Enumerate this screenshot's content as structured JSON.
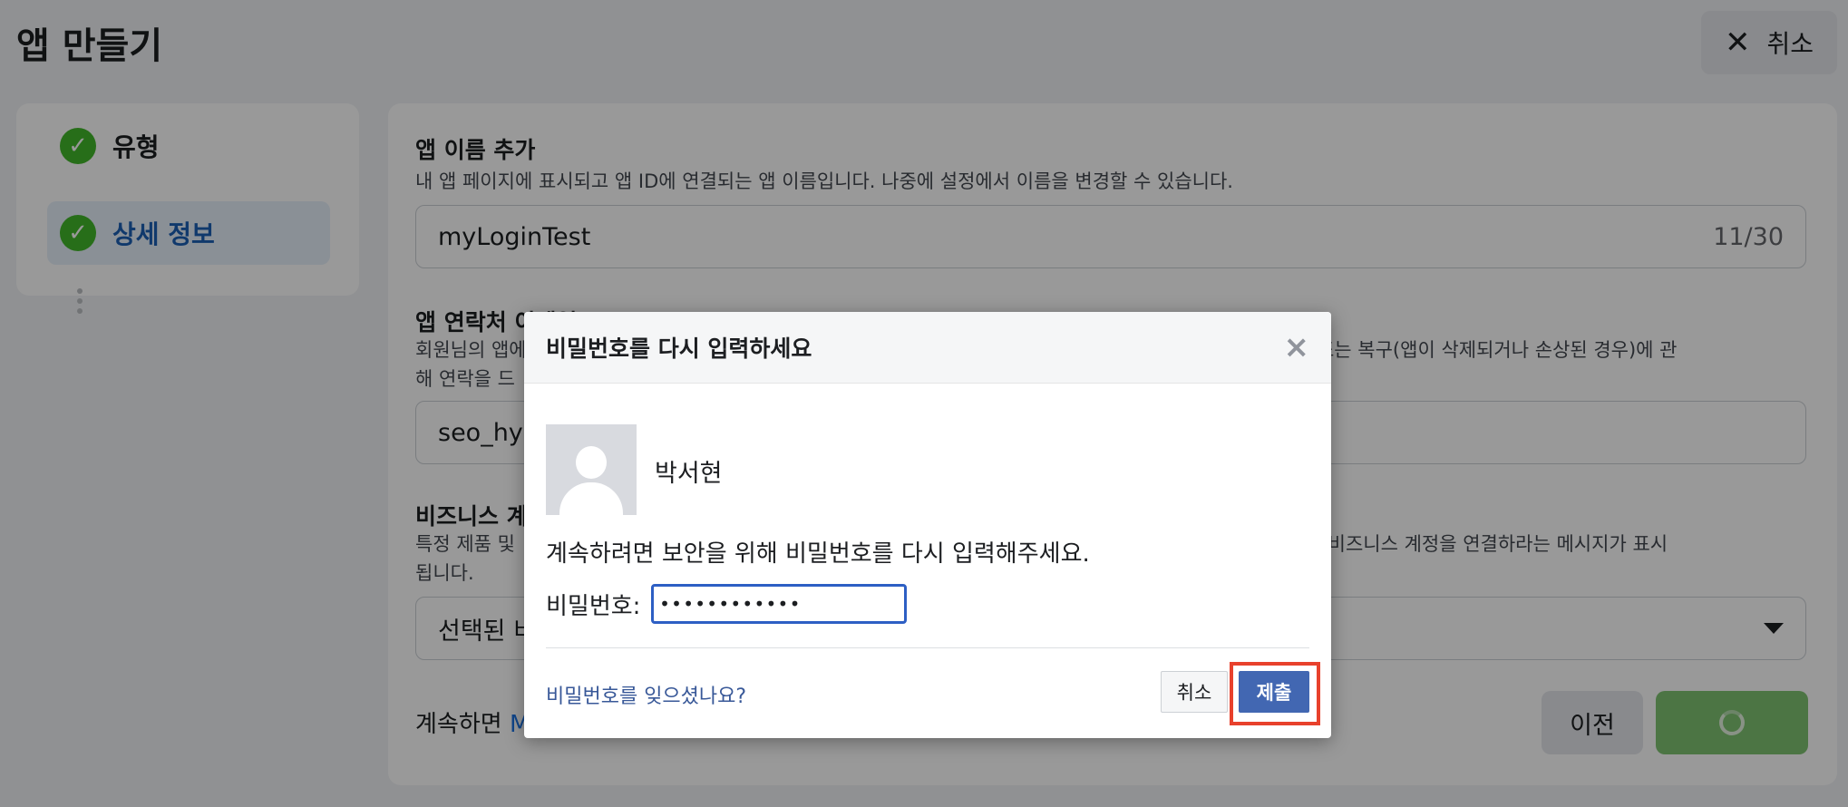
{
  "header": {
    "title": "앱 만들기",
    "cancel_label": "취소"
  },
  "steps": [
    {
      "label": "유형",
      "status": "complete"
    },
    {
      "label": "상세 정보",
      "status": "current"
    }
  ],
  "form": {
    "app_name": {
      "label": "앱 이름 추가",
      "description": "내 앱 페이지에 표시되고 앱 ID에 연결되는 앱 이름입니다. 나중에 설정에서 이름을 변경할 수 있습니다.",
      "value": "myLoginTest",
      "counter": "11/30"
    },
    "contact_email": {
      "label": "앱 연락처 이메일",
      "description_left": "회원님의 앱에",
      "description_right": "택, 앱 제한 또는 복구(앱이 삭제되거나 손상된 경우)에 관",
      "description_line2": "해 연락을 드",
      "value": "seo_hye"
    },
    "business": {
      "label": "비즈니스 계",
      "description_left": "특정 제품 및",
      "description_right": "을 요청할 때 비즈니스 계정을 연결하라는 메시지가 표시",
      "description_line2": "됩니다.",
      "selected": "선택된 비"
    },
    "terms_prefix": "계속하면",
    "terms_link": "M",
    "prev_label": "이전"
  },
  "dialog": {
    "title": "비밀번호를 다시 입력하세요",
    "close_glyph": "×",
    "user_name": "박서현",
    "instruction": "계속하려면 보안을 위해 비밀번호를 다시 입력해주세요.",
    "password_label": "비밀번호:",
    "password_value": "••••••••••••",
    "forgot_link": "비밀번호를 잊으셨나요?",
    "cancel_label": "취소",
    "submit_label": "제출"
  }
}
